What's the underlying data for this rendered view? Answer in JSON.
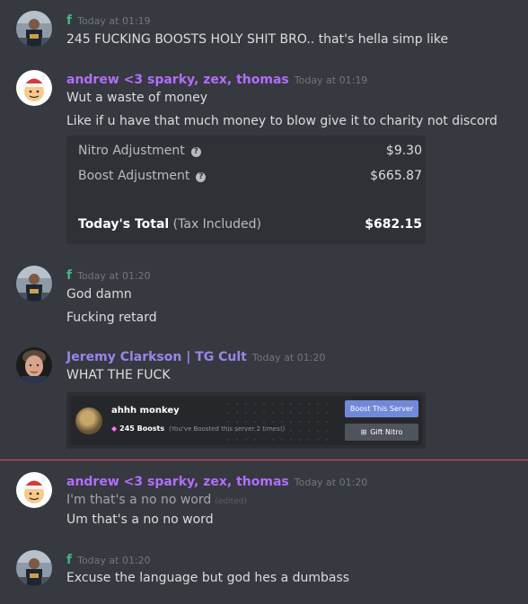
{
  "users": {
    "f": {
      "name": "f",
      "color": "#43b581"
    },
    "andrew": {
      "name": "andrew <3 sparky, zex, thomas",
      "color": "#b36dff"
    },
    "jeremy": {
      "name": "Jeremy Clarkson | TG Cult",
      "color": "#9b84ec"
    }
  },
  "messages": {
    "m1": {
      "ts": "Today at 01:19",
      "lines": [
        "245 FUCKING BOOSTS HOLY SHIT BRO.. that's hella simp like"
      ]
    },
    "m2": {
      "ts": "Today at 01:19",
      "lines": [
        "Wut a waste of money",
        "Like if u have that much money to blow give it to charity not discord"
      ]
    },
    "m3": {
      "ts": "Today at 01:20",
      "lines": [
        "God damn",
        "Fucking retard"
      ]
    },
    "m4": {
      "ts": "Today at 01:20",
      "lines": [
        "WHAT THE FUCK"
      ]
    },
    "m5": {
      "ts": "Today at 01:20",
      "lines": [
        "I'm that's a no no word",
        "Um that's a no no word"
      ],
      "edited": "(edited)"
    },
    "m6": {
      "ts": "Today at 01:20",
      "lines": [
        "Excuse the language but god hes a dumbass"
      ]
    }
  },
  "invoice": {
    "nitro_label": "Nitro Adjustment",
    "nitro_value": "$9.30",
    "boost_label": "Boost Adjustment",
    "boost_value": "$665.87",
    "total_label": "Today's Total",
    "total_note": "(Tax Included)",
    "total_value": "$682.15",
    "help_icon": "?"
  },
  "boost_embed": {
    "server_name": "ahhh monkey",
    "boost_count": "245 Boosts",
    "boost_note": "(You've Boosted this server 2 times!)",
    "boost_button": "Boost This Server",
    "gift_button": "Gift Nitro",
    "gem_icon": "◆",
    "gift_icon": "⊞"
  },
  "colors": {
    "background": "#36393f",
    "embed": "#2f3136",
    "new_divider": "#f04747",
    "blurple": "#7289da"
  }
}
